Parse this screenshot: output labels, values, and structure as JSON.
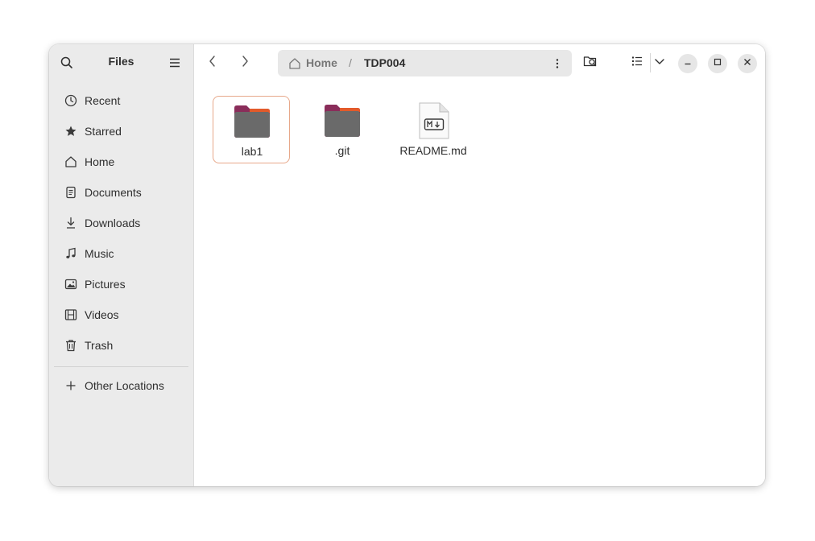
{
  "app": {
    "title": "Files"
  },
  "sidebar": {
    "items": [
      {
        "label": "Recent",
        "icon": "clock-icon"
      },
      {
        "label": "Starred",
        "icon": "star-icon"
      },
      {
        "label": "Home",
        "icon": "home-icon"
      },
      {
        "label": "Documents",
        "icon": "document-icon"
      },
      {
        "label": "Downloads",
        "icon": "download-icon"
      },
      {
        "label": "Music",
        "icon": "music-note-icon"
      },
      {
        "label": "Pictures",
        "icon": "picture-icon"
      },
      {
        "label": "Videos",
        "icon": "film-icon"
      },
      {
        "label": "Trash",
        "icon": "trash-icon"
      }
    ],
    "other_locations": {
      "label": "Other Locations",
      "icon": "plus-icon"
    }
  },
  "pathbar": {
    "home": "Home",
    "separator": "/",
    "current": "TDP004"
  },
  "files": [
    {
      "name": "lab1",
      "type": "folder",
      "selected": true
    },
    {
      "name": ".git",
      "type": "folder",
      "selected": false
    },
    {
      "name": "README.md",
      "type": "markdown",
      "selected": false
    }
  ],
  "colors": {
    "folder_body": "#6a6a6a",
    "folder_tab": "#8a2d5a",
    "folder_accent": "#e35a2a",
    "selection_border": "#e7a88a",
    "sidebar_bg": "#ebebeb"
  }
}
